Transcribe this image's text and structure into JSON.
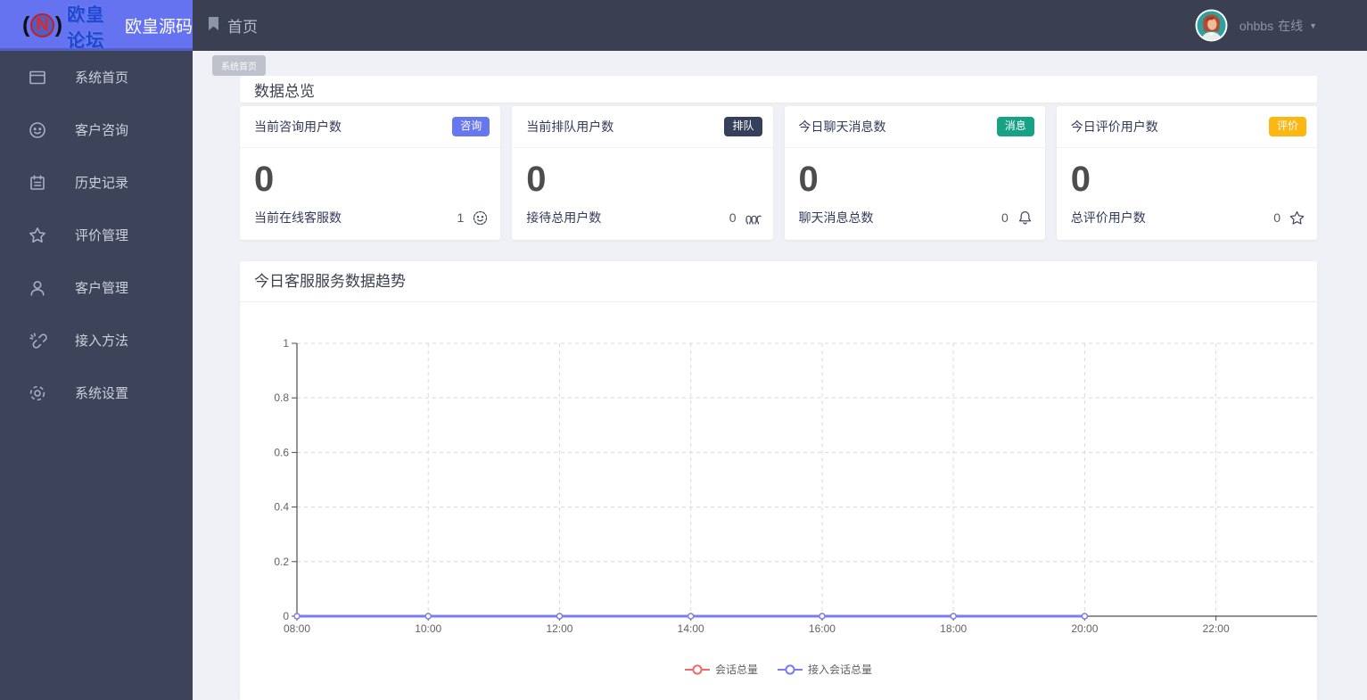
{
  "theme": {
    "primary": "#6673f0",
    "header_bg": "#3a4052",
    "sidebar_bg": "#3d4459"
  },
  "brand": {
    "logo_paren_left": "(",
    "logo_letter": "N",
    "logo_paren_right": ")",
    "logo_text": "欧皇论坛",
    "brand_name": "欧皇源码"
  },
  "navbar": {
    "home_label": "首页",
    "user_name": "ohbbs",
    "user_status": "在线",
    "caret_icon": "▼"
  },
  "sidebar": {
    "items": [
      {
        "label": "系统首页",
        "icon": "window-icon"
      },
      {
        "label": "客户咨询",
        "icon": "smiley-icon"
      },
      {
        "label": "历史记录",
        "icon": "notebook-icon"
      },
      {
        "label": "评价管理",
        "icon": "star-icon"
      },
      {
        "label": "客户管理",
        "icon": "user-icon"
      },
      {
        "label": "接入方法",
        "icon": "unlink-icon"
      },
      {
        "label": "系统设置",
        "icon": "gear-icon"
      }
    ]
  },
  "content": {
    "corner_tag": "系统首页",
    "section_title": "数据总览",
    "stat_cards": [
      {
        "title": "当前咨询用户数",
        "badge": "咨询",
        "badge_color": "#6777ef",
        "value": "0",
        "footer_label": "当前在线客服数",
        "footer_value": "1",
        "footer_icon": "smiley-icon"
      },
      {
        "title": "当前排队用户数",
        "badge": "排队",
        "badge_color": "#34405c",
        "value": "0",
        "footer_label": "接待总用户数",
        "footer_value": "0",
        "footer_icon": "queue-icon"
      },
      {
        "title": "今日聊天消息数",
        "badge": "消息",
        "badge_color": "#17a286",
        "value": "0",
        "footer_label": "聊天消息总数",
        "footer_value": "0",
        "footer_icon": "bell-icon"
      },
      {
        "title": "今日评价用户数",
        "badge": "评价",
        "badge_color": "#fcb712",
        "value": "0",
        "footer_label": "总评价用户数",
        "footer_value": "0",
        "footer_icon": "star-icon"
      }
    ],
    "chart_card_title": "今日客服服务数据趋势"
  },
  "chart_data": {
    "type": "line",
    "title": "今日客服服务数据趋势",
    "categories": [
      "08:00",
      "10:00",
      "12:00",
      "14:00",
      "16:00",
      "18:00",
      "20:00",
      "22:00"
    ],
    "x_data": [
      "08:00",
      "10:00",
      "12:00",
      "14:00",
      "16:00",
      "18:00",
      "20:00"
    ],
    "series": [
      {
        "name": "会话总量",
        "color": "#ee6b6b",
        "values": [
          0,
          0,
          0,
          0,
          0,
          0,
          0
        ]
      },
      {
        "name": "接入会话总量",
        "color": "#7a7cf5",
        "values": [
          0,
          0,
          0,
          0,
          0,
          0,
          0
        ]
      }
    ],
    "ylim": [
      0,
      1
    ],
    "yticks": [
      0,
      0.2,
      0.4,
      0.6,
      0.8,
      1
    ],
    "xlabel": "",
    "ylabel": "",
    "grid": "dashed",
    "legend_position": "bottom"
  }
}
